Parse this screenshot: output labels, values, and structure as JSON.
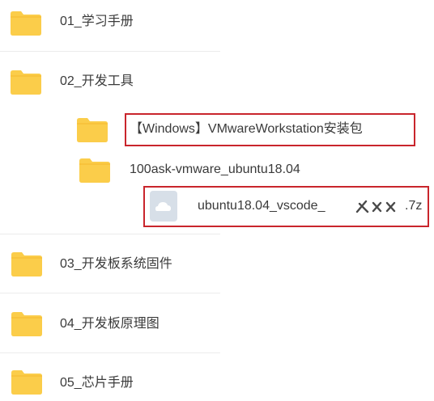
{
  "items": [
    {
      "label": "01_学习手册",
      "type": "folder"
    },
    {
      "label": "02_开发工具",
      "type": "folder"
    },
    {
      "label": "【Windows】VMwareWorkstation安装包",
      "type": "folder"
    },
    {
      "label": "100ask-vmware_ubuntu18.04",
      "type": "folder"
    },
    {
      "label_prefix": "ubuntu18.04_vscode_",
      "label_suffix": ".7z",
      "type": "archive-file"
    },
    {
      "label": "03_开发板系统固件",
      "type": "folder"
    },
    {
      "label": "04_开发板原理图",
      "type": "folder"
    },
    {
      "label": "05_芯片手册",
      "type": "folder"
    }
  ],
  "colors": {
    "folder": "#fbcd4a",
    "folder_tab": "#f4b92d",
    "highlight": "#c9252c",
    "file_icon": "#d7dfe8",
    "text": "#3a3a3a"
  },
  "icons": {
    "folder": "folder-icon",
    "file": "cloud-file-icon",
    "redaction": "scribble-redaction"
  }
}
